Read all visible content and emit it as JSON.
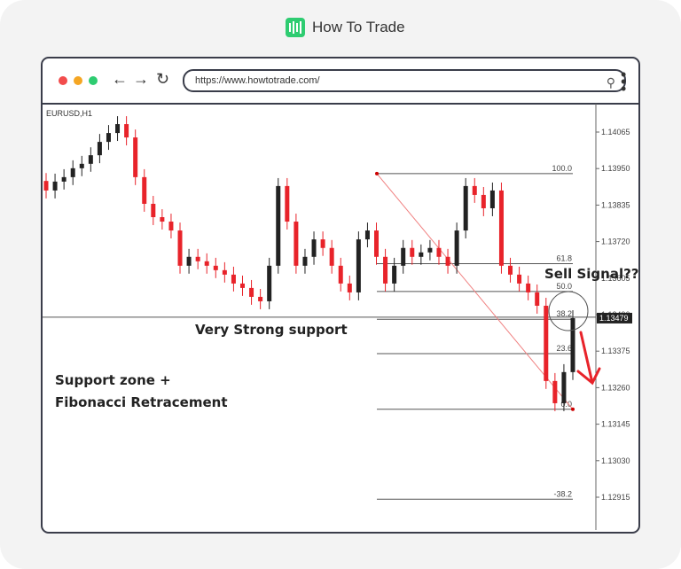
{
  "brand": {
    "name": "How To Trade",
    "logo_color": "#2ecc71"
  },
  "browser": {
    "url": "https://www.howtotrade.com/",
    "icons": [
      "back-arrow-icon",
      "forward-arrow-icon",
      "reload-icon",
      "search-icon",
      "kebab-menu-icon"
    ],
    "dot_colors": [
      "#f24c4c",
      "#f5a623",
      "#2ecc71"
    ]
  },
  "chart_data": {
    "type": "candlestick",
    "symbol_label": "EURUSD,H1",
    "ylim": [
      1.1287,
      1.1415
    ],
    "y_ticks": [
      "1.14065",
      "1.13950",
      "1.13835",
      "1.13720",
      "1.13605",
      "1.13490",
      "1.13375",
      "1.13260",
      "1.13145",
      "1.13030",
      "1.12915"
    ],
    "closes": [
      1.13881,
      1.13909,
      1.13923,
      1.13951,
      1.13965,
      1.13992,
      1.14034,
      1.14062,
      1.1409,
      1.14048,
      1.13923,
      1.13839,
      1.13797,
      1.13783,
      1.13755,
      1.13644,
      1.13672,
      1.13658,
      1.13644,
      1.1363,
      1.13616,
      1.13588,
      1.13574,
      1.13546,
      1.13532,
      1.13644,
      1.13895,
      1.13783,
      1.13644,
      1.13672,
      1.13727,
      1.137,
      1.13644,
      1.13588,
      1.1356,
      1.13727,
      1.13755,
      1.13672,
      1.13588,
      1.13644,
      1.137,
      1.13672,
      1.13686,
      1.137,
      1.13672,
      1.13644,
      1.13755,
      1.13895,
      1.13867,
      1.13825,
      1.13881,
      1.13644,
      1.13616,
      1.13588,
      1.1356,
      1.13518,
      1.13281,
      1.13211,
      1.13309,
      1.13479
    ],
    "current_price": "1.13479",
    "support_level": 1.13482,
    "fibonacci": {
      "high": 1.13934,
      "low": 1.13192,
      "levels": [
        {
          "ratio": 1.0,
          "label": "100.0"
        },
        {
          "ratio": 0.618,
          "label": "61.8"
        },
        {
          "ratio": 0.5,
          "label": "50.0"
        },
        {
          "ratio": 0.382,
          "label": "38.2"
        },
        {
          "ratio": 0.236,
          "label": "23.6"
        },
        {
          "ratio": 0.0,
          "label": "0.0"
        },
        {
          "ratio": -0.382,
          "label": "-38.2"
        }
      ]
    },
    "colors": {
      "bull": "#222222",
      "bear": "#e8232a",
      "fib_line": "#555555",
      "trend_line": "#f08080",
      "arrow": "#e8232a"
    },
    "annotations": {
      "support": "Very Strong support",
      "zone_line1": "Support zone +",
      "zone_line2": "Fibonacci Retracement",
      "sell": "Sell Signal??"
    }
  }
}
